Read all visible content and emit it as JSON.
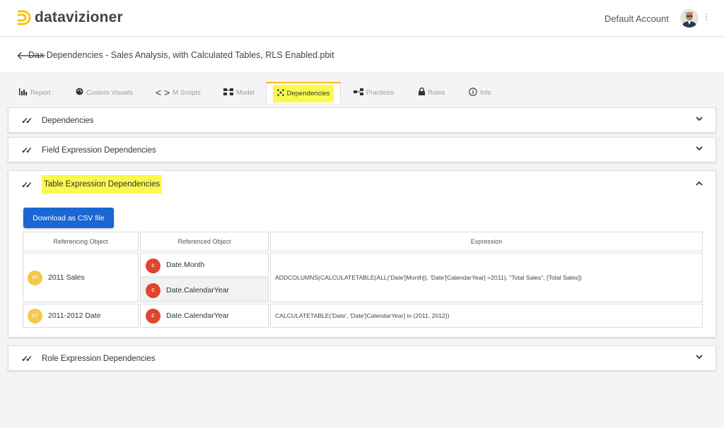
{
  "brand": {
    "name": "datavizioner",
    "accent": "#f3c316"
  },
  "header": {
    "account_label": "Default Account",
    "menu_icon": "kebab-icon"
  },
  "file": {
    "title": "Dax Dependencies - Sales Analysis, with Calculated Tables, RLS Enabled.pbit"
  },
  "tabs": [
    {
      "label": "Report",
      "icon": "bar-chart-icon"
    },
    {
      "label": "Custom Visuals",
      "icon": "palette-icon"
    },
    {
      "label": "M Scripts",
      "icon": "code-icon"
    },
    {
      "label": "Model",
      "icon": "model-icon"
    },
    {
      "label": "Dependencies",
      "icon": "dependencies-icon",
      "active": true
    },
    {
      "label": "Practices",
      "icon": "practices-icon"
    },
    {
      "label": "Roles",
      "icon": "lock-icon"
    },
    {
      "label": "Info",
      "icon": "info-icon"
    }
  ],
  "panels": {
    "dependencies": {
      "title": "Dependencies"
    },
    "field": {
      "title": "Field Expression Dependencies"
    },
    "table": {
      "title": "Table Expression Dependencies",
      "download_label": "Download as CSV file"
    },
    "role": {
      "title": "Role Expression Dependencies"
    }
  },
  "table": {
    "headers": [
      "Referencing Object",
      "Referenced Object",
      "Expression"
    ],
    "badge_ct": "CT",
    "badge_c": "C",
    "rows": [
      {
        "referencing": "2011 Sales",
        "referenced": [
          "Date.Month",
          "Date.CalendarYear"
        ],
        "expression": "ADDCOLUMNS(CALCULATETABLE(ALL('Date'[Month]), 'Date'[CalendarYear] =2011), \"Total Sales\", [Total Sales])"
      },
      {
        "referencing": "2011-2012 Date",
        "referenced": [
          "Date.CalendarYear"
        ],
        "expression": "CALCULATETABLE('Date', 'Date'[CalendarYear] in (2011, 2012))"
      }
    ]
  }
}
